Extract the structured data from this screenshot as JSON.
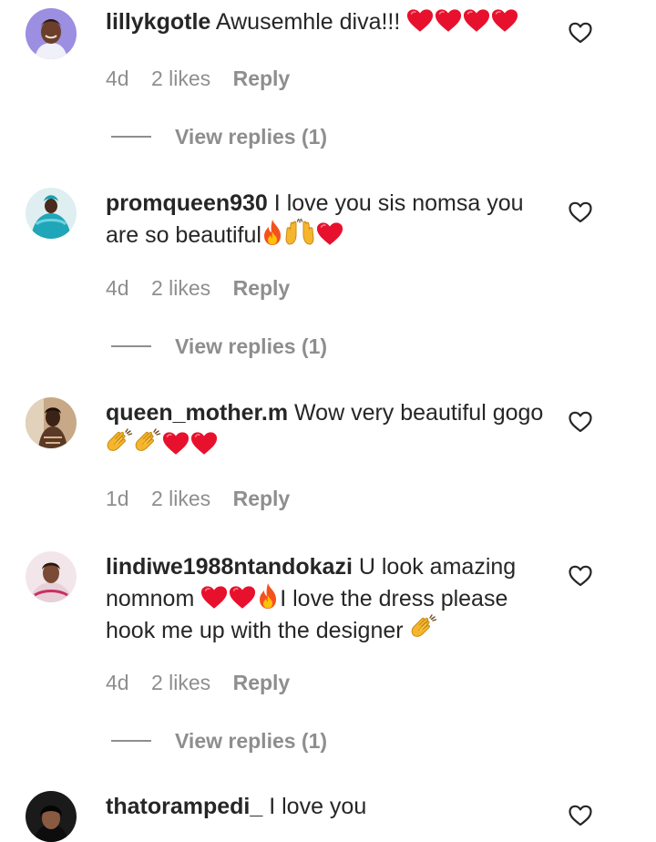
{
  "comments": [
    {
      "username": "lillykgotle",
      "text": "Awusemhle diva!!!",
      "time": "4d",
      "likes": "2 likes",
      "reply": "Reply",
      "view_replies": "View replies (1)"
    },
    {
      "username": "promqueen930",
      "text": "I love you sis nomsa you are so beautiful",
      "time": "4d",
      "likes": "2 likes",
      "reply": "Reply",
      "view_replies": "View replies (1)"
    },
    {
      "username": "queen_mother.m",
      "text": "Wow very beautiful gogo",
      "time": "1d",
      "likes": "2 likes",
      "reply": "Reply"
    },
    {
      "username": "lindiwe1988ntandokazi",
      "text_a": "U look amazing nomnom",
      "text_b": "I love the dress please hook me up with the designer",
      "time": "4d",
      "likes": "2 likes",
      "reply": "Reply",
      "view_replies": "View replies (1)"
    },
    {
      "username": "thatorampedi_",
      "text": "I love you"
    }
  ],
  "icons": {
    "like": "heart-outline-icon",
    "red_heart": "red-heart-emoji",
    "fire": "fire-emoji",
    "clap": "clapping-hands-emoji",
    "raised": "raising-hands-emoji"
  },
  "colors": {
    "text": "#262626",
    "secondary": "#8e8e8e",
    "heart_red": "#e8112d"
  }
}
